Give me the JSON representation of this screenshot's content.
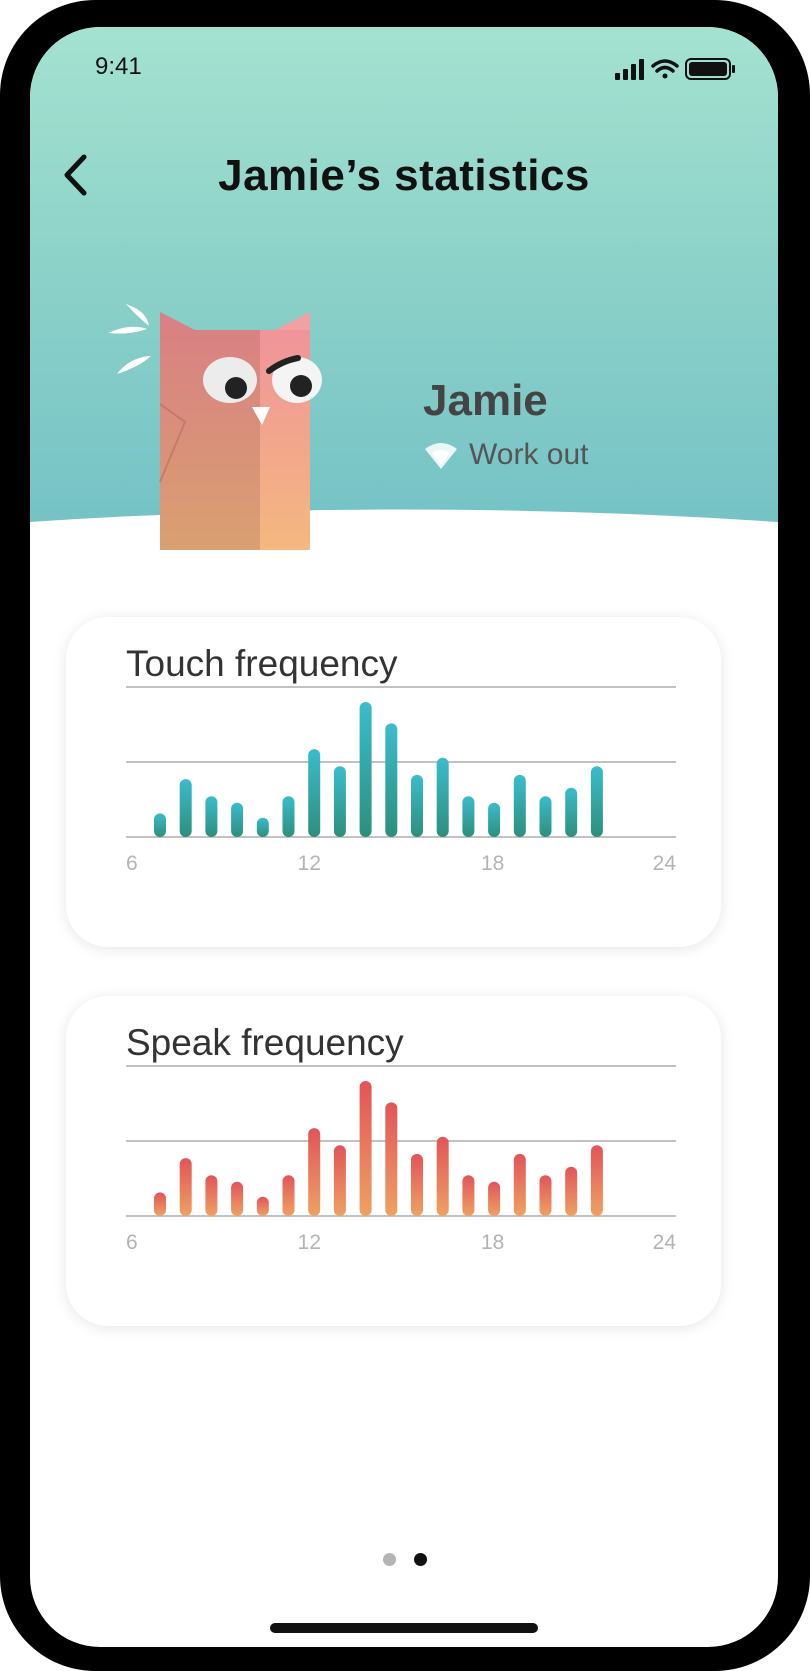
{
  "status": {
    "time": "9:41"
  },
  "header": {
    "title": "Jamie’s statistics"
  },
  "pet": {
    "name": "Jamie",
    "status": "Work out"
  },
  "colors": {
    "header_top": "#a4e2d0",
    "header_bottom": "#73c1c6",
    "touch_top": "#3bbccd",
    "touch_bottom": "#2d8f7c",
    "speak_top": "#e2545a",
    "speak_bottom": "#eea162"
  },
  "chart_data": [
    {
      "type": "bar",
      "title": "Touch frequency",
      "x_ticks": [
        "6",
        "12",
        "18",
        "24"
      ],
      "xlim": [
        6,
        24
      ],
      "x": [
        7,
        8,
        9,
        10,
        11,
        12,
        13,
        14,
        15,
        16,
        17,
        18,
        19,
        20,
        21,
        22,
        23
      ],
      "values": [
        11,
        27,
        19,
        16,
        9,
        19,
        41,
        33,
        63,
        53,
        29,
        37,
        19,
        16,
        29,
        19,
        23,
        33
      ],
      "ylim": [
        0,
        70
      ],
      "grid": true
    },
    {
      "type": "bar",
      "title": "Speak frequency",
      "x_ticks": [
        "6",
        "12",
        "18",
        "24"
      ],
      "xlim": [
        6,
        24
      ],
      "x": [
        7,
        8,
        9,
        10,
        11,
        12,
        13,
        14,
        15,
        16,
        17,
        18,
        19,
        20,
        21,
        22,
        23
      ],
      "values": [
        11,
        27,
        19,
        16,
        9,
        19,
        41,
        33,
        63,
        53,
        29,
        37,
        19,
        16,
        29,
        19,
        23,
        33
      ],
      "ylim": [
        0,
        70
      ],
      "grid": true
    }
  ],
  "pagination": {
    "total": 2,
    "active": 2
  }
}
